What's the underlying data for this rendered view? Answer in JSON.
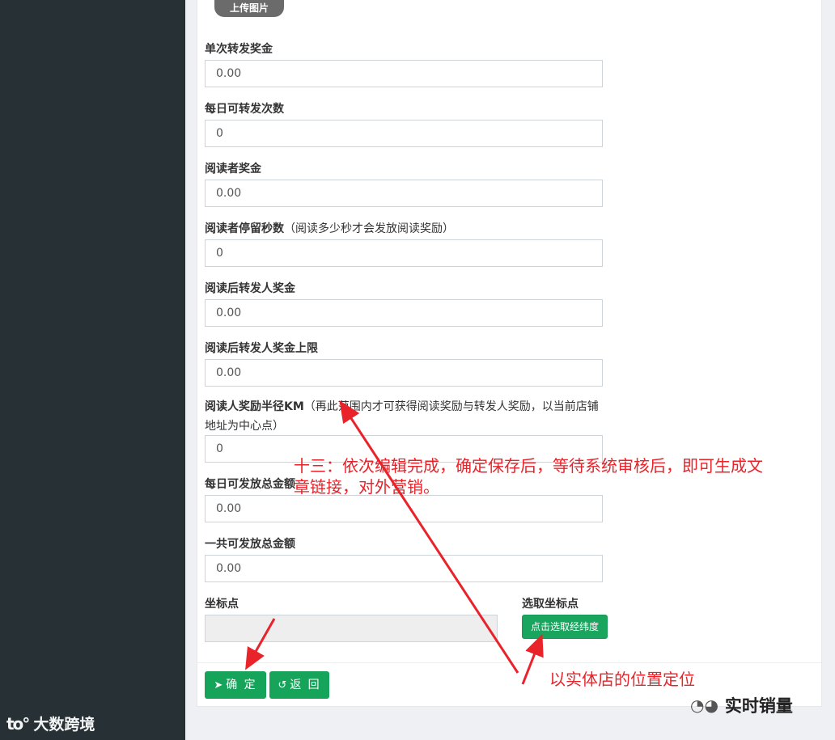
{
  "sidebar": {
    "watermark_logo": "to°",
    "watermark_text": "大数跨境"
  },
  "form": {
    "upload_label": "上传图片",
    "fields": [
      {
        "label": "单次转发奖金",
        "hint": "",
        "value": "0.00"
      },
      {
        "label": "每日可转发次数",
        "hint": "",
        "value": "0"
      },
      {
        "label": "阅读者奖金",
        "hint": "",
        "value": "0.00"
      },
      {
        "label": "阅读者停留秒数",
        "hint": "（阅读多少秒才会发放阅读奖励）",
        "value": "0"
      },
      {
        "label": "阅读后转发人奖金",
        "hint": "",
        "value": "0.00"
      },
      {
        "label": "阅读后转发人奖金上限",
        "hint": "",
        "value": "0.00"
      },
      {
        "label": "阅读人奖励半径KM",
        "hint": "（再此范围内才可获得阅读奖励与转发人奖励，以当前店铺地址为中心点）",
        "value": "0"
      },
      {
        "label": "每日可发放总金额",
        "hint": "",
        "value": "0.00"
      },
      {
        "label": "一共可发放总金额",
        "hint": "",
        "value": "0.00"
      }
    ],
    "coord_label": "坐标点",
    "coord_value": "",
    "pick_label": "选取坐标点",
    "pick_button": "点击选取经纬度",
    "confirm_button": "确 定",
    "back_button": "返 回"
  },
  "annotations": {
    "main": "十三：依次编辑完成，确定保存后，等待系统审核后，即可生成文章链接，对外营销。",
    "location": "以实体店的位置定位"
  },
  "branding": {
    "wechat_name": "实时销量"
  },
  "colors": {
    "sidebar": "#263035",
    "primary_green": "#16a35a",
    "annotation_red": "#e8232a"
  },
  "icons": {
    "confirm": "paper-plane-icon",
    "back": "back-arrow-icon"
  }
}
